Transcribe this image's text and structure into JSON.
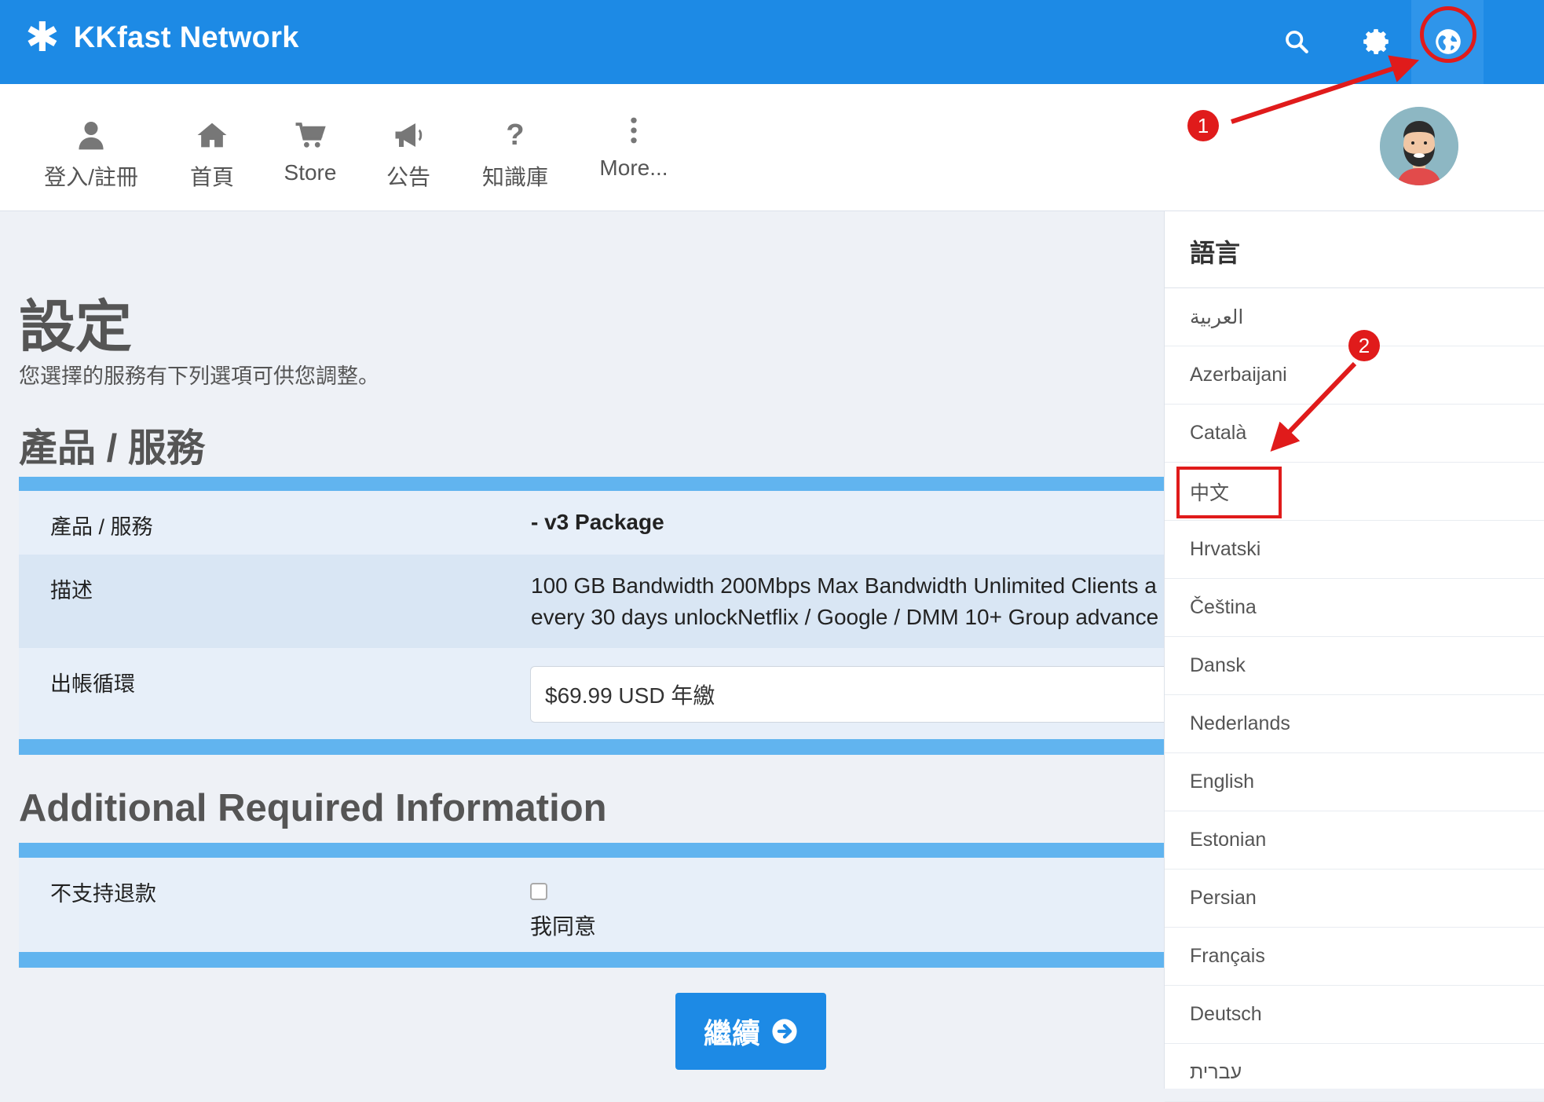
{
  "topbar": {
    "brand": "KKfast Network",
    "icons": [
      "search-icon",
      "gear-icon",
      "globe-icon"
    ],
    "color": "#1d8ae5"
  },
  "nav": {
    "items": [
      {
        "label": "登入/註冊",
        "icon": "user-icon"
      },
      {
        "label": "首頁",
        "icon": "home-icon"
      },
      {
        "label": "Store",
        "icon": "cart-icon"
      },
      {
        "label": "公告",
        "icon": "megaphone-icon"
      },
      {
        "label": "知識庫",
        "icon": "question-icon"
      },
      {
        "label": "More...",
        "icon": "more-vertical-icon"
      }
    ]
  },
  "main": {
    "title": "設定",
    "subtitle": "您選擇的服務有下列選項可供您調整。",
    "product_section": {
      "heading": "產品 / 服務",
      "rows": [
        {
          "label": "產品 / 服務",
          "value": "- v3 Package"
        },
        {
          "label": "描述",
          "value_line1": "100 GB Bandwidth 200Mbps Max Bandwidth Unlimited Clients a",
          "value_line2": "every 30 days unlockNetflix / Google / DMM 10+ Group advance"
        },
        {
          "label": "出帳循環",
          "value": "$69.99 USD 年繳"
        }
      ]
    },
    "additional_section": {
      "heading": "Additional Required Information",
      "row": {
        "label": "不支持退款",
        "checkbox_label": "我同意",
        "checked": false
      }
    },
    "continue_label": "繼續"
  },
  "language_panel": {
    "title": "語言",
    "items": [
      "العربية",
      "Azerbaijani",
      "Català",
      "中文",
      "Hrvatski",
      "Čeština",
      "Dansk",
      "Nederlands",
      "English",
      "Estonian",
      "Persian",
      "Français",
      "Deutsch",
      "עברית"
    ],
    "highlighted": "中文"
  },
  "annotations": {
    "badge1": "1",
    "badge2": "2",
    "color": "#e01b1b"
  }
}
